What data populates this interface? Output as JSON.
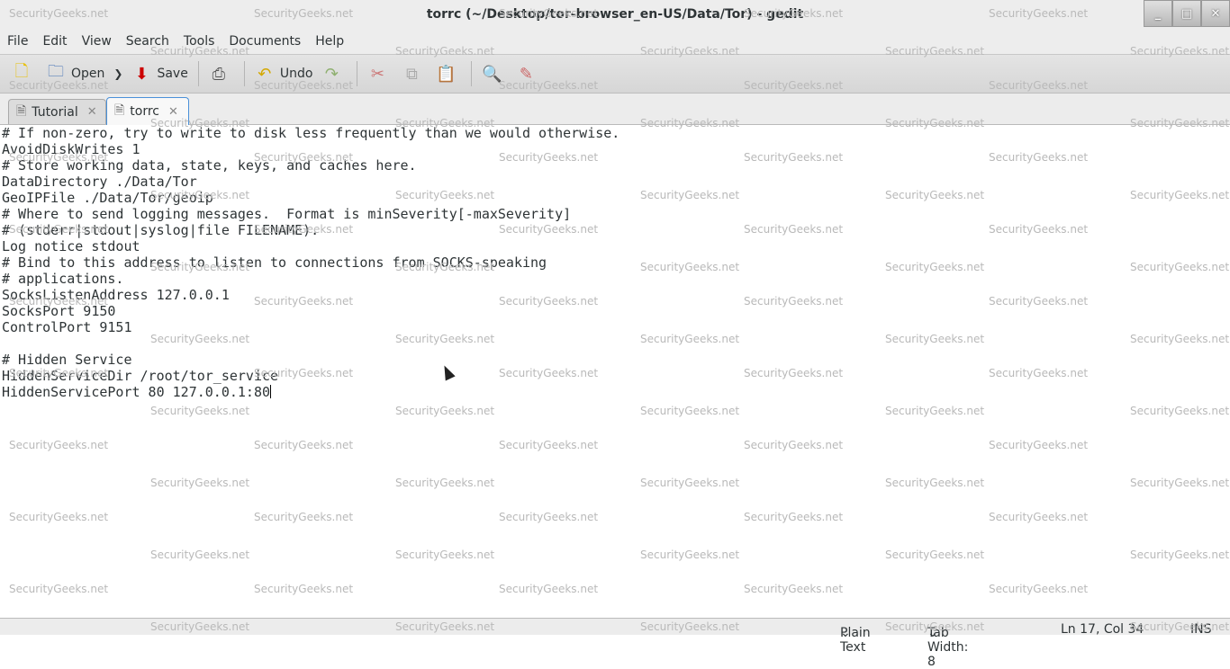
{
  "window": {
    "title": "torrc (~/Desktop/tor-browser_en-US/Data/Tor) - gedit",
    "minimize": "_",
    "maximize": "□",
    "close": "✕"
  },
  "menu": [
    "File",
    "Edit",
    "View",
    "Search",
    "Tools",
    "Documents",
    "Help"
  ],
  "toolbar": {
    "open": "Open",
    "save": "Save",
    "undo": "Undo"
  },
  "icons": [
    "new-document-icon",
    "open-folder-icon",
    "chevron-down-icon",
    "save-icon",
    "print-icon",
    "undo-icon",
    "redo-icon",
    "cut-icon",
    "copy-icon",
    "paste-icon",
    "search-icon",
    "replace-icon"
  ],
  "tabs": [
    {
      "label": "Tutorial",
      "active": false
    },
    {
      "label": "torrc",
      "active": true
    }
  ],
  "editor": {
    "lines": [
      "# If non-zero, try to write to disk less frequently than we would otherwise.",
      "AvoidDiskWrites 1",
      "# Store working data, state, keys, and caches here.",
      "DataDirectory ./Data/Tor",
      "GeoIPFile ./Data/Tor/geoip",
      "# Where to send logging messages.  Format is minSeverity[-maxSeverity]",
      "# (stderr|stdout|syslog|file FILENAME).",
      "Log notice stdout",
      "# Bind to this address to listen to connections from SOCKS-speaking",
      "# applications.",
      "SocksListenAddress 127.0.0.1",
      "SocksPort 9150",
      "ControlPort 9151",
      "",
      "# Hidden Service",
      "HiddenServiceDir /root/tor_service",
      "HiddenServicePort 80 127.0.0.1:80"
    ]
  },
  "status": {
    "language": "Plain Text",
    "tab_width": "Tab Width:  8",
    "position": "Ln 17, Col 34",
    "mode": "INS"
  },
  "watermark": "SecurityGeeks.net"
}
